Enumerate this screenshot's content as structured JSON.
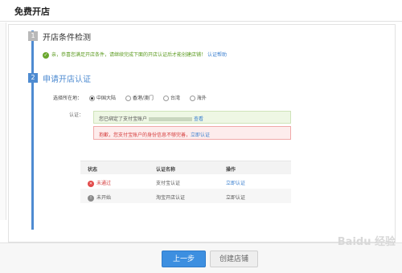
{
  "page": {
    "title": "免费开店"
  },
  "steps": [
    {
      "num": "1",
      "title": "开店条件检测"
    },
    {
      "num": "2",
      "title": "申请开店认证"
    }
  ],
  "step1": {
    "message": "亲，恭喜您满足开店条件，请继续完成下面的开店认证后才能创建店铺！",
    "help_link": "认证帮助"
  },
  "region": {
    "label": "选择所在地：",
    "options": [
      "中国大陆",
      "香港/澳门",
      "台湾",
      "海外"
    ],
    "selected": "中国大陆"
  },
  "auth": {
    "label": "认证：",
    "bound_text": "您已绑定了支付宝账户",
    "bound_link": "查看",
    "warning_text": "抱歉，您支付宝账户的身份信息不够完善",
    "warning_link": "立即认证"
  },
  "table": {
    "headers": [
      "状态",
      "认证名称",
      "操作"
    ],
    "rows": [
      {
        "status": "未通过",
        "name": "支付宝认证",
        "action": "立即认证",
        "status_type": "fail"
      },
      {
        "status": "未开始",
        "name": "淘宝开店认证",
        "action": "立即认证",
        "status_type": "pending"
      }
    ]
  },
  "footer": {
    "prev_label": "上一步",
    "create_label": "创建店铺"
  },
  "colors": {
    "accent": "#4e8bd1",
    "success": "#6aa72d",
    "error": "#d43b3b",
    "primary_button": "#3d8fe0"
  },
  "watermark": "Baidu 经验"
}
